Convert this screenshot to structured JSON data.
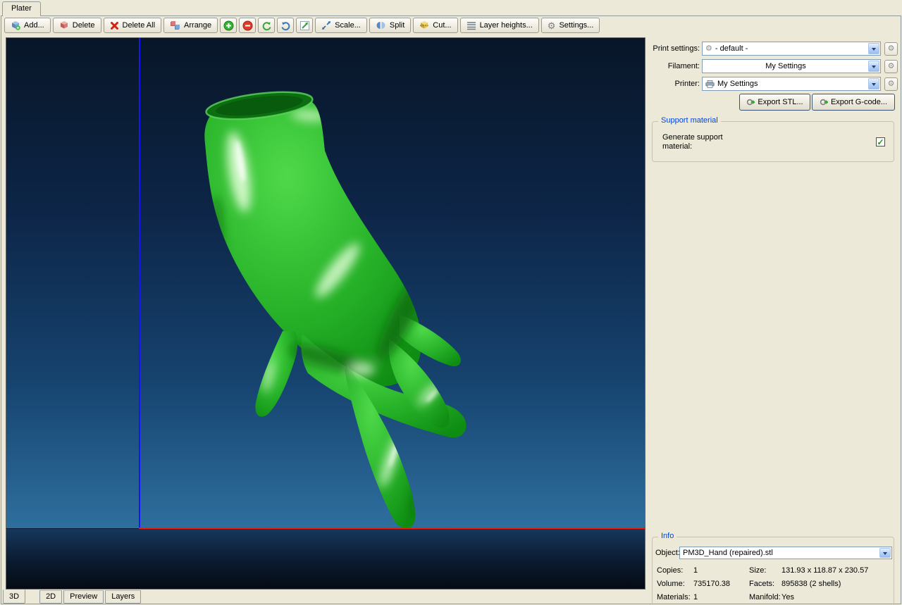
{
  "window": {
    "plater_tab": "Plater"
  },
  "toolbar": {
    "add": "Add...",
    "delete": "Delete",
    "delete_all": "Delete All",
    "arrange": "Arrange",
    "scale": "Scale...",
    "split": "Split",
    "cut": "Cut...",
    "layer_heights": "Layer heights...",
    "settings": "Settings..."
  },
  "right_panel": {
    "print_settings_label": "Print settings:",
    "print_settings_value": "- default -",
    "filament_label": "Filament:",
    "filament_value": "My Settings",
    "printer_label": "Printer:",
    "printer_value": "My Settings",
    "export_stl": "Export STL...",
    "export_gcode": "Export G-code...",
    "support": {
      "group_title": "Support material",
      "generate_label": "Generate support material:",
      "checked": true,
      "check_glyph": "✓"
    },
    "info": {
      "group_title": "Info",
      "object_label": "Object:",
      "object_value": "PM3D_Hand (repaired).stl",
      "rows": [
        {
          "l1": "Copies:",
          "v1": "1",
          "l2": "Size:",
          "v2": "131.93 x 118.87 x 230.57"
        },
        {
          "l1": "Volume:",
          "v1": "735170.38",
          "l2": "Facets:",
          "v2": "895838 (2 shells)"
        },
        {
          "l1": "Materials:",
          "v1": "1",
          "l2": "Manifold:",
          "v2": "Yes"
        }
      ]
    }
  },
  "view_tabs": [
    {
      "label": "3D"
    },
    {
      "label": "2D"
    },
    {
      "label": "Preview"
    },
    {
      "label": "Layers"
    }
  ]
}
